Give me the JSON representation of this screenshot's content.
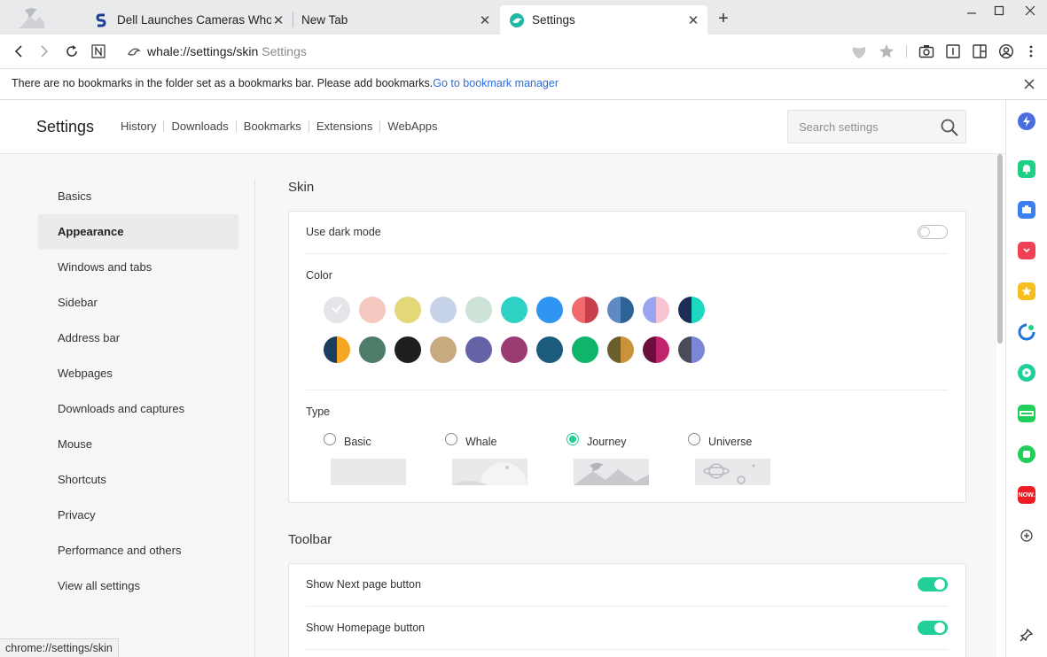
{
  "tabs": [
    {
      "title": "Dell Launches Cameras Whose",
      "close": "✕",
      "active": false
    },
    {
      "title": "New Tab",
      "close": "✕",
      "active": false
    },
    {
      "title": "Settings",
      "close": "✕",
      "active": true
    }
  ],
  "new_tab_label": "+",
  "window_controls": {
    "minimize": "—",
    "maximize": "☐",
    "close": "✕"
  },
  "toolbar": {
    "url": "whale://settings/skin",
    "url_context": "Settings",
    "icons": [
      "back-icon",
      "forward-icon",
      "reload-icon",
      "naver-icon",
      "site-info-icon",
      "shield-icon",
      "bookmark-star-icon",
      "camera-icon",
      "reader-icon",
      "split-view-icon",
      "profile-icon",
      "menu-icon"
    ]
  },
  "bookmark_notice": {
    "message": "There are no bookmarks in the folder set as a bookmarks bar. Please add bookmarks.",
    "link": "Go to bookmark manager",
    "close": "✕"
  },
  "settings_header": {
    "title": "Settings",
    "nav": [
      "History",
      "Downloads",
      "Bookmarks",
      "Extensions",
      "WebApps"
    ],
    "search_placeholder": "Search settings"
  },
  "left_nav": {
    "active": "Appearance",
    "items": [
      "Basics",
      "Appearance",
      "Windows and tabs",
      "Sidebar",
      "Address bar",
      "Webpages",
      "Downloads and captures",
      "Mouse",
      "Shortcuts",
      "Privacy",
      "Performance and others",
      "View all settings"
    ]
  },
  "skin": {
    "title": "Skin",
    "dark_mode_label": "Use dark mode",
    "dark_mode_on": false,
    "color_label": "Color",
    "selected_color_index": 0,
    "colors": [
      [
        "#e4e5e8"
      ],
      [
        "#f4c8bf"
      ],
      [
        "#e3d777"
      ],
      [
        "#c6d2e8"
      ],
      [
        "#cde3d7"
      ],
      [
        "#2fd1c4"
      ],
      [
        "#2f94f2"
      ],
      [
        "#f06a6e",
        "#c5404c"
      ],
      [
        "#5d8ac3",
        "#2e6396"
      ],
      [
        "#9ba4f0",
        "#f6c3d3"
      ],
      [
        "#1d2d57",
        "#1dd8c0"
      ],
      [
        "#1b3d5e",
        "#f7a623"
      ],
      [
        "#4d7d69"
      ],
      [
        "#1e1f21"
      ],
      [
        "#c8aa80"
      ],
      [
        "#6563a5"
      ],
      [
        "#9b3b73"
      ],
      [
        "#1b5b7b"
      ],
      [
        "#0fb56a"
      ],
      [
        "#6a5e2c",
        "#c8933c"
      ],
      [
        "#6c0f3e",
        "#c0246e"
      ],
      [
        "#4a4c5a",
        "#7c86d6"
      ]
    ],
    "type_label": "Type",
    "types": [
      "Basic",
      "Whale",
      "Journey",
      "Universe"
    ],
    "selected_type": "Journey",
    "accent": "#21cf99"
  },
  "toolbar_section": {
    "title": "Toolbar",
    "rows": [
      {
        "label": "Show Next page button",
        "on": true
      },
      {
        "label": "Show Homepage button",
        "on": true
      }
    ]
  },
  "sidebar_apps": [
    {
      "name": "whale-lightning-icon",
      "color": "#4a6ee0"
    },
    {
      "name": "notification-bell-icon",
      "color": "#1fcf86"
    },
    {
      "name": "toolbox-icon",
      "color": "#3a7ef0"
    },
    {
      "name": "pocket-icon",
      "color": "#ef4056"
    },
    {
      "name": "favorites-star-icon",
      "color": "#f6bf1f"
    },
    {
      "name": "dictionary-icon",
      "color": "#1f76d8"
    },
    {
      "name": "music-player-icon",
      "color": "#1fcf9a"
    },
    {
      "name": "webtoon-icon",
      "color": "#1fcf5a"
    },
    {
      "name": "memo-icon",
      "color": "#1fcf5a"
    },
    {
      "name": "now-icon",
      "color": "#ee1d24",
      "text": "NOW."
    },
    {
      "name": "add-app-icon",
      "color": "#333333"
    },
    {
      "name": "pin-icon",
      "color": "#333333"
    }
  ],
  "status_url": "chrome://settings/skin"
}
